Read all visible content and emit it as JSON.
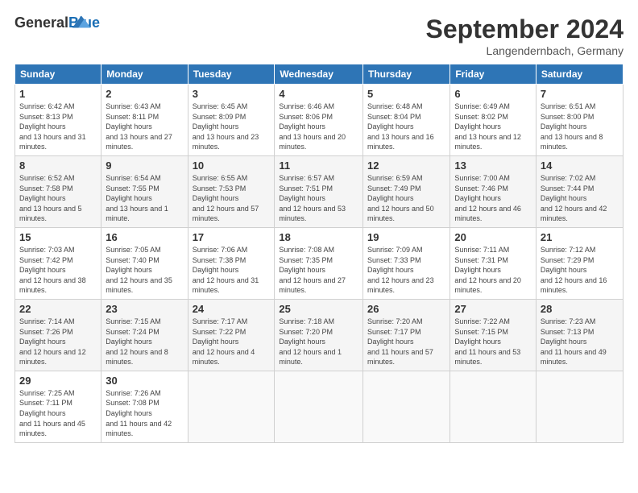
{
  "header": {
    "logo_general": "General",
    "logo_blue": "Blue",
    "month_title": "September 2024",
    "location": "Langendernbach, Germany"
  },
  "weekdays": [
    "Sunday",
    "Monday",
    "Tuesday",
    "Wednesday",
    "Thursday",
    "Friday",
    "Saturday"
  ],
  "weeks": [
    [
      {
        "day": "1",
        "sunrise": "6:42 AM",
        "sunset": "8:13 PM",
        "daylight": "13 hours and 31 minutes."
      },
      {
        "day": "2",
        "sunrise": "6:43 AM",
        "sunset": "8:11 PM",
        "daylight": "13 hours and 27 minutes."
      },
      {
        "day": "3",
        "sunrise": "6:45 AM",
        "sunset": "8:09 PM",
        "daylight": "13 hours and 23 minutes."
      },
      {
        "day": "4",
        "sunrise": "6:46 AM",
        "sunset": "8:06 PM",
        "daylight": "13 hours and 20 minutes."
      },
      {
        "day": "5",
        "sunrise": "6:48 AM",
        "sunset": "8:04 PM",
        "daylight": "13 hours and 16 minutes."
      },
      {
        "day": "6",
        "sunrise": "6:49 AM",
        "sunset": "8:02 PM",
        "daylight": "13 hours and 12 minutes."
      },
      {
        "day": "7",
        "sunrise": "6:51 AM",
        "sunset": "8:00 PM",
        "daylight": "13 hours and 8 minutes."
      }
    ],
    [
      {
        "day": "8",
        "sunrise": "6:52 AM",
        "sunset": "7:58 PM",
        "daylight": "13 hours and 5 minutes."
      },
      {
        "day": "9",
        "sunrise": "6:54 AM",
        "sunset": "7:55 PM",
        "daylight": "13 hours and 1 minute."
      },
      {
        "day": "10",
        "sunrise": "6:55 AM",
        "sunset": "7:53 PM",
        "daylight": "12 hours and 57 minutes."
      },
      {
        "day": "11",
        "sunrise": "6:57 AM",
        "sunset": "7:51 PM",
        "daylight": "12 hours and 53 minutes."
      },
      {
        "day": "12",
        "sunrise": "6:59 AM",
        "sunset": "7:49 PM",
        "daylight": "12 hours and 50 minutes."
      },
      {
        "day": "13",
        "sunrise": "7:00 AM",
        "sunset": "7:46 PM",
        "daylight": "12 hours and 46 minutes."
      },
      {
        "day": "14",
        "sunrise": "7:02 AM",
        "sunset": "7:44 PM",
        "daylight": "12 hours and 42 minutes."
      }
    ],
    [
      {
        "day": "15",
        "sunrise": "7:03 AM",
        "sunset": "7:42 PM",
        "daylight": "12 hours and 38 minutes."
      },
      {
        "day": "16",
        "sunrise": "7:05 AM",
        "sunset": "7:40 PM",
        "daylight": "12 hours and 35 minutes."
      },
      {
        "day": "17",
        "sunrise": "7:06 AM",
        "sunset": "7:38 PM",
        "daylight": "12 hours and 31 minutes."
      },
      {
        "day": "18",
        "sunrise": "7:08 AM",
        "sunset": "7:35 PM",
        "daylight": "12 hours and 27 minutes."
      },
      {
        "day": "19",
        "sunrise": "7:09 AM",
        "sunset": "7:33 PM",
        "daylight": "12 hours and 23 minutes."
      },
      {
        "day": "20",
        "sunrise": "7:11 AM",
        "sunset": "7:31 PM",
        "daylight": "12 hours and 20 minutes."
      },
      {
        "day": "21",
        "sunrise": "7:12 AM",
        "sunset": "7:29 PM",
        "daylight": "12 hours and 16 minutes."
      }
    ],
    [
      {
        "day": "22",
        "sunrise": "7:14 AM",
        "sunset": "7:26 PM",
        "daylight": "12 hours and 12 minutes."
      },
      {
        "day": "23",
        "sunrise": "7:15 AM",
        "sunset": "7:24 PM",
        "daylight": "12 hours and 8 minutes."
      },
      {
        "day": "24",
        "sunrise": "7:17 AM",
        "sunset": "7:22 PM",
        "daylight": "12 hours and 4 minutes."
      },
      {
        "day": "25",
        "sunrise": "7:18 AM",
        "sunset": "7:20 PM",
        "daylight": "12 hours and 1 minute."
      },
      {
        "day": "26",
        "sunrise": "7:20 AM",
        "sunset": "7:17 PM",
        "daylight": "11 hours and 57 minutes."
      },
      {
        "day": "27",
        "sunrise": "7:22 AM",
        "sunset": "7:15 PM",
        "daylight": "11 hours and 53 minutes."
      },
      {
        "day": "28",
        "sunrise": "7:23 AM",
        "sunset": "7:13 PM",
        "daylight": "11 hours and 49 minutes."
      }
    ],
    [
      {
        "day": "29",
        "sunrise": "7:25 AM",
        "sunset": "7:11 PM",
        "daylight": "11 hours and 45 minutes."
      },
      {
        "day": "30",
        "sunrise": "7:26 AM",
        "sunset": "7:08 PM",
        "daylight": "11 hours and 42 minutes."
      },
      null,
      null,
      null,
      null,
      null
    ]
  ]
}
